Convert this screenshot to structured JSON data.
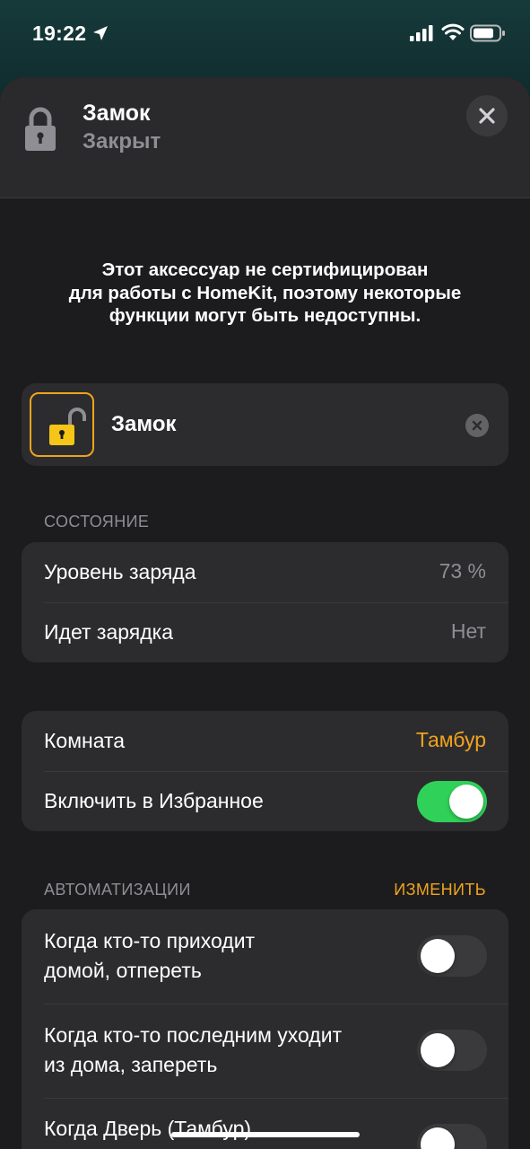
{
  "status_bar": {
    "time": "19:22"
  },
  "header": {
    "title": "Замок",
    "subtitle": "Закрыт"
  },
  "notice": {
    "lines": [
      "Этот аксессуар не сертифицирован",
      "для работы с HomeKit, поэтому некоторые",
      "функции могут быть недоступны."
    ]
  },
  "accessory": {
    "name": "Замок"
  },
  "status_section": {
    "label": "СОСТОЯНИЕ",
    "rows": [
      {
        "label": "Уровень заряда",
        "value": "73 %"
      },
      {
        "label": "Идет зарядка",
        "value": "Нет"
      }
    ]
  },
  "settings_section": {
    "room_label": "Комната",
    "room_value": "Тамбур",
    "favorite_label": "Включить в Избранное",
    "favorite_on": true
  },
  "automations": {
    "label": "АВТОМАТИЗАЦИИ",
    "edit": "ИЗМЕНИТЬ",
    "items": [
      {
        "line1": "Когда кто-то приходит",
        "line2": "домой, отпереть",
        "on": false
      },
      {
        "line1": "Когда кто-то последним уходит",
        "line2": "из дома, запереть",
        "on": false
      },
      {
        "line1": "Когда Дверь (Тамбур)",
        "line2": "",
        "on": false
      }
    ]
  },
  "colors": {
    "accent": "#f0a31c",
    "toggle_on": "#30d158",
    "card": "#2c2c2e",
    "sheet": "#1c1c1e"
  }
}
